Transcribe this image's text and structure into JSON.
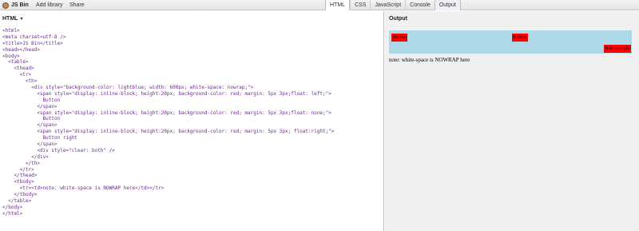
{
  "topbar": {
    "brand": "JS Bin",
    "add_library": "Add library",
    "share": "Share",
    "tabs": [
      "HTML",
      "CSS",
      "JavaScript",
      "Console",
      "Output"
    ]
  },
  "html_pane": {
    "title": "HTML",
    "caret": "▾",
    "code_lines": [
      "<html>",
      "<meta charset=utf-8 />",
      "<title>JS Bin</title>",
      "<head></head>",
      "<body>",
      "  <table>",
      "    <thead>",
      "      <tr>",
      "        <th>",
      "          <div style=\"background-color: lightblue; width: 600px; white-space: nowrap;\">",
      "            <span style=\"display: inline-block; height:20px; background-color: red; margin: 5px 3px;float: left;\">",
      "              Button",
      "            </span>",
      "            <span style=\"display: inline-block; height:20px; background-color: red; margin: 5px 3px;float: none;\">",
      "              Button",
      "            </span>",
      "            <span style=\"display: inline-block; height:20px; background-color: red; margin: 5px 3px; float:right;\">",
      "              Button right",
      "            </span>",
      "            <div style=\"clear: both\" />",
      "          </div>",
      "        </th>",
      "      </tr>",
      "    </thead>",
      "    <tbody>",
      "      <tr><td>note: white-space is NOWRAP here</td></tr>",
      "    </tbody>",
      "  </table>",
      "</body>",
      "</html>"
    ]
  },
  "output_pane": {
    "title": "Output",
    "button_left": "Button",
    "button_middle": "Button",
    "button_right": "Button right",
    "note": "note: white-space is NOWRAP here"
  }
}
